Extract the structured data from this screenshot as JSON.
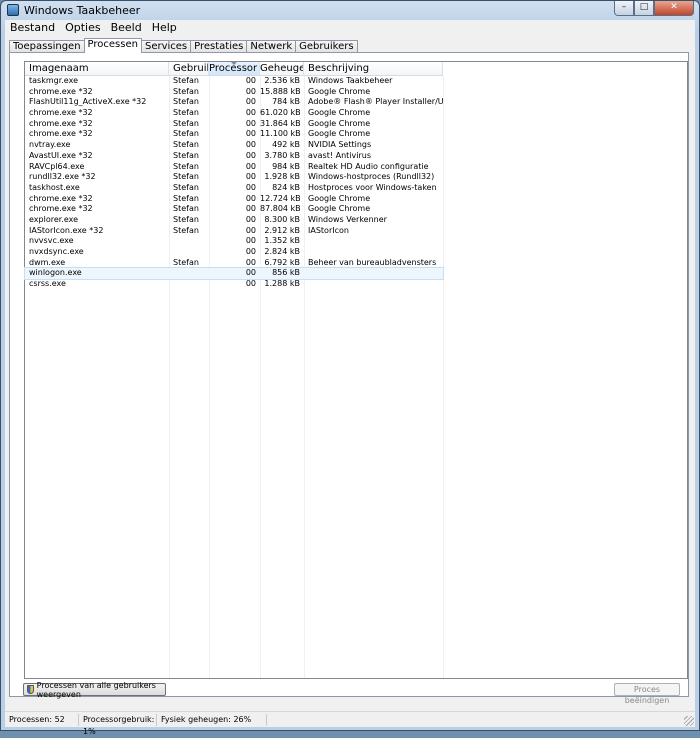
{
  "window": {
    "title": "Windows Taakbeheer",
    "controls": {
      "minimize": "–",
      "maximize": "□",
      "close": "✕"
    }
  },
  "menu": {
    "items": [
      "Bestand",
      "Opties",
      "Beeld",
      "Help"
    ]
  },
  "tabs": [
    "Toepassingen",
    "Processen",
    "Services",
    "Prestaties",
    "Netwerk",
    "Gebruikers"
  ],
  "active_tab": "Processen",
  "table": {
    "columns": [
      "Imagenaam",
      "Gebruik...",
      "Processor",
      "Geheuge...",
      "Beschrijving"
    ],
    "sorted_column": "Processor",
    "rows": [
      [
        "taskmgr.exe",
        "Stefan",
        "00",
        "2.536 kB",
        "Windows Taakbeheer"
      ],
      [
        "chrome.exe *32",
        "Stefan",
        "00",
        "15.888 kB",
        "Google Chrome"
      ],
      [
        "FlashUtil11g_ActiveX.exe *32",
        "Stefan",
        "00",
        "784 kB",
        "Adobe® Flash® Player Installer/Uninsta..."
      ],
      [
        "chrome.exe *32",
        "Stefan",
        "00",
        "61.020 kB",
        "Google Chrome"
      ],
      [
        "chrome.exe *32",
        "Stefan",
        "00",
        "31.864 kB",
        "Google Chrome"
      ],
      [
        "chrome.exe *32",
        "Stefan",
        "00",
        "11.100 kB",
        "Google Chrome"
      ],
      [
        "nvtray.exe",
        "Stefan",
        "00",
        "492 kB",
        "NVIDIA Settings"
      ],
      [
        "AvastUI.exe *32",
        "Stefan",
        "00",
        "3.780 kB",
        "avast! Antivirus"
      ],
      [
        "RAVCpl64.exe",
        "Stefan",
        "00",
        "984 kB",
        "Realtek HD Audio configuratie"
      ],
      [
        "rundll32.exe *32",
        "Stefan",
        "00",
        "1.928 kB",
        "Windows-hostproces (Rundll32)"
      ],
      [
        "taskhost.exe",
        "Stefan",
        "00",
        "824 kB",
        "Hostproces voor Windows-taken"
      ],
      [
        "chrome.exe *32",
        "Stefan",
        "00",
        "12.724 kB",
        "Google Chrome"
      ],
      [
        "chrome.exe *32",
        "Stefan",
        "00",
        "87.804 kB",
        "Google Chrome"
      ],
      [
        "explorer.exe",
        "Stefan",
        "00",
        "8.300 kB",
        "Windows Verkenner"
      ],
      [
        "IAStorIcon.exe *32",
        "Stefan",
        "00",
        "2.912 kB",
        "IAStorIcon"
      ],
      [
        "nvvsvc.exe",
        "",
        "00",
        "1.352 kB",
        ""
      ],
      [
        "nvxdsync.exe",
        "",
        "00",
        "2.824 kB",
        ""
      ],
      [
        "dwm.exe",
        "Stefan",
        "00",
        "6.792 kB",
        "Beheer van bureaubladvensters"
      ],
      [
        "winlogon.exe",
        "",
        "00",
        "856 kB",
        ""
      ],
      [
        "csrss.exe",
        "",
        "00",
        "1.288 kB",
        ""
      ]
    ],
    "selected_row": "winlogon.exe"
  },
  "buttons": {
    "show_all": "Processen van alle gebruikers weergeven",
    "end_process": "Proces beëindigen"
  },
  "status": {
    "processes": "Processen: 52",
    "cpu": "Processorgebruik: 1%",
    "memory": "Fysiek geheugen: 26%"
  }
}
